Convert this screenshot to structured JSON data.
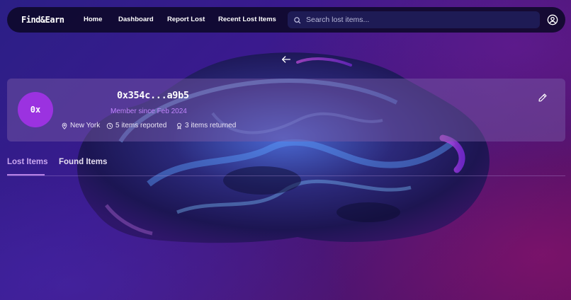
{
  "brand": {
    "logo": "Find&Earn"
  },
  "nav": {
    "links": [
      "Home",
      "Dashboard",
      "Report Lost",
      "Recent Lost Items"
    ],
    "search_placeholder": "Search lost items...",
    "icons": {
      "search": "search-icon",
      "profile": "user-circle-icon",
      "back": "arrow-left-icon"
    }
  },
  "profile": {
    "avatar_text": "0x",
    "wallet_address": "0x354c...a9b5",
    "member_since": "Member since Feb 2024",
    "location": "New York",
    "items_reported": "5 items reported",
    "items_returned": "3 items returned",
    "icons": {
      "location": "map-pin-icon",
      "reported": "clock-icon",
      "returned": "award-icon",
      "edit": "pencil-icon"
    }
  },
  "tabs": {
    "items": [
      "Lost Items",
      "Found Items"
    ],
    "active": "Lost Items"
  },
  "colors": {
    "accent": "#9b32e0",
    "member_since": "#c084fc",
    "tab_active": "#c9a6f0",
    "navbar_bg": "#0c0828"
  }
}
